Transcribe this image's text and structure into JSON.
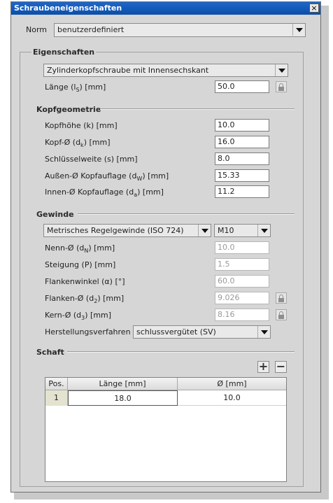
{
  "window": {
    "title": "Schraubeneigenschaften",
    "close_glyph": "×"
  },
  "norm": {
    "label": "Norm",
    "value": "benutzerdefiniert"
  },
  "eigenschaften": {
    "title": "Eigenschaften",
    "type_value": "Zylinderkopfschraube mit Innensechskant",
    "laenge": {
      "label_pre": "Länge (l",
      "label_sub": "S",
      "label_post": ") [mm]",
      "value": "50.0"
    }
  },
  "kopfgeometrie": {
    "title": "Kopfgeometrie",
    "fields": [
      {
        "label_pre": "Kopfhöhe (k) [mm]",
        "label_sub": "",
        "label_post": "",
        "value": "10.0"
      },
      {
        "label_pre": "Kopf-Ø (d",
        "label_sub": "k",
        "label_post": ") [mm]",
        "value": "16.0"
      },
      {
        "label_pre": "Schlüsselweite (s) [mm]",
        "label_sub": "",
        "label_post": "",
        "value": "8.0"
      },
      {
        "label_pre": "Außen-Ø Kopfauflage (d",
        "label_sub": "W",
        "label_post": ") [mm]",
        "value": "15.33"
      },
      {
        "label_pre": "Innen-Ø Kopfauflage (d",
        "label_sub": "a",
        "label_post": ") [mm]",
        "value": "11.2"
      }
    ]
  },
  "gewinde": {
    "title": "Gewinde",
    "thread_type": "Metrisches Regelgewinde (ISO 724)",
    "size": "M10",
    "fields": [
      {
        "label_pre": "Nenn-Ø (d",
        "label_sub": "N",
        "label_post": ") [mm]",
        "value": "10.0"
      },
      {
        "label_pre": "Steigung (P) [mm]",
        "label_sub": "",
        "label_post": "",
        "value": "1.5"
      },
      {
        "label_pre": "Flankenwinkel (α) [°]",
        "label_sub": "",
        "label_post": "",
        "value": "60.0"
      },
      {
        "label_pre": "Flanken-Ø (d",
        "label_sub": "2",
        "label_post": ") [mm]",
        "value": "9.026"
      },
      {
        "label_pre": "Kern-Ø (d",
        "label_sub": "3",
        "label_post": ") [mm]",
        "value": "8.16"
      }
    ],
    "herstellung": {
      "label": "Herstellungsverfahren",
      "value": "schlussvergütet (SV)"
    }
  },
  "schaft": {
    "title": "Schaft",
    "add_glyph": "+",
    "remove_glyph": "−",
    "columns": [
      "Pos.",
      "Länge [mm]",
      "Ø [mm]"
    ],
    "rows": [
      {
        "pos": "1",
        "laenge": "18.0",
        "d": "10.0"
      }
    ]
  }
}
